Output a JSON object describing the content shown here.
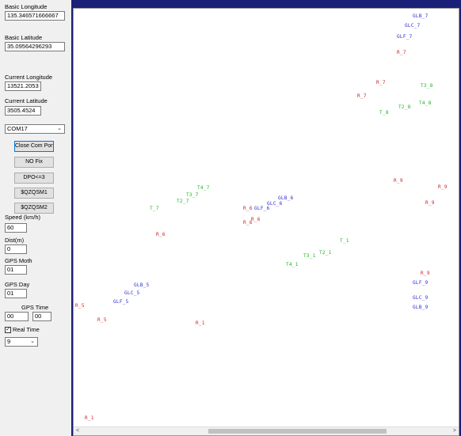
{
  "panel": {
    "basic_longitude_label": "Basic Longitude",
    "basic_longitude_value": "135.346571666667",
    "basic_latitude_label": "Basic Latitude",
    "basic_latitude_value": "35.09564296293",
    "current_longitude_label": "Current Longitude",
    "current_longitude_value": "13521.2053",
    "current_latitude_label": "Current Latitude",
    "current_latitude_value": "3505.4524",
    "com_port_value": "COM17",
    "buttons": {
      "close_com_port": "Close Com Port",
      "no_fix": "NO Fix",
      "dpo": "DPO<=3",
      "qzqsm1": "$QZQSM1",
      "qzqsm2": "$QZQSM2"
    },
    "speed_label": "Speed (km/h)",
    "speed_value": "60",
    "dist_label": "Dist(m)",
    "dist_value": "0",
    "gps_month_label": "GPS Moth",
    "gps_month_value": "01",
    "gps_day_label": "GPS Day",
    "gps_day_value": "01",
    "gps_time_label": "GPS Time",
    "gps_time_hour": "00",
    "gps_time_min": "00",
    "real_time_label": "Real Time",
    "real_time_checked": true,
    "interval_value": "9"
  },
  "colors": {
    "red": "#d02020",
    "green": "#22b022",
    "blue": "#2a2ad0"
  },
  "points": [
    {
      "label": "GLB_7",
      "color": "blue"
    },
    {
      "label": "GLC_7",
      "color": "blue"
    },
    {
      "label": "GLF_7",
      "color": "blue"
    },
    {
      "label": "R_7",
      "color": "red"
    },
    {
      "label": "R_7",
      "color": "red"
    },
    {
      "label": "T3_8",
      "color": "green"
    },
    {
      "label": "R_7",
      "color": "red"
    },
    {
      "label": "T4_8",
      "color": "green"
    },
    {
      "label": "T2_8",
      "color": "green"
    },
    {
      "label": "T_8",
      "color": "green"
    },
    {
      "label": "R_9",
      "color": "red"
    },
    {
      "label": "R_9",
      "color": "red"
    },
    {
      "label": "R_9",
      "color": "red"
    },
    {
      "label": "T4_7",
      "color": "green"
    },
    {
      "label": "T3_7",
      "color": "green"
    },
    {
      "label": "T2_7",
      "color": "green"
    },
    {
      "label": "T_7",
      "color": "green"
    },
    {
      "label": "GLB_6",
      "color": "blue"
    },
    {
      "label": "GLC_6",
      "color": "blue"
    },
    {
      "label": "GLF_6",
      "color": "blue"
    },
    {
      "label": "R_6",
      "color": "red"
    },
    {
      "label": "R_6",
      "color": "red"
    },
    {
      "label": "R_6",
      "color": "red"
    },
    {
      "label": "R_6",
      "color": "red"
    },
    {
      "label": "T_1",
      "color": "green"
    },
    {
      "label": "T2_1",
      "color": "green"
    },
    {
      "label": "T3_1",
      "color": "green"
    },
    {
      "label": "T4_1",
      "color": "green"
    },
    {
      "label": "R_9",
      "color": "red"
    },
    {
      "label": "GLF_9",
      "color": "blue"
    },
    {
      "label": "GLC_9",
      "color": "blue"
    },
    {
      "label": "GLB_9",
      "color": "blue"
    },
    {
      "label": "GLB_5",
      "color": "blue"
    },
    {
      "label": "GLC_5",
      "color": "blue"
    },
    {
      "label": "GLF_5",
      "color": "blue"
    },
    {
      "label": "R_5",
      "color": "red"
    },
    {
      "label": "R_5",
      "color": "red"
    },
    {
      "label": "R_1",
      "color": "red"
    },
    {
      "label": "R_1",
      "color": "red"
    }
  ]
}
